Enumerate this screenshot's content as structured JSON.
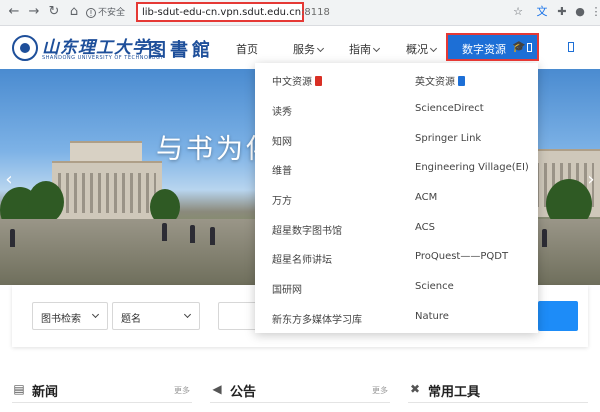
{
  "browser": {
    "not_secure": "不安全",
    "url": "lib-sdut-edu-cn.vpn.sdut.edu.cn",
    "port": ":8118"
  },
  "site": {
    "logo_main": "山东理工大学",
    "logo_sub": "SHANDONG UNIVERSITY OF TECHNOLOGY",
    "logo_lib": "图書館",
    "nav": {
      "home": "首页",
      "service": "服务",
      "guide": "指南",
      "overview": "概况",
      "digital": "数字资源"
    }
  },
  "hero": {
    "title": "与书为伴"
  },
  "search": {
    "type_select": "图书检索",
    "field_select": "题名"
  },
  "dropdown": {
    "left": [
      "中文资源",
      "读秀",
      "知网",
      "维普",
      "万方",
      "超星数字图书馆",
      "超星名师讲坛",
      "国研网",
      "新东方多媒体学习库"
    ],
    "right": [
      "英文资源",
      "ScienceDirect",
      "Springer Link",
      "Engineering Village(EI)",
      "ACM",
      "ACS",
      "ProQuest——PQDT",
      "Science",
      "Nature"
    ],
    "badge_colors": {
      "chinese": "#d93025",
      "english": "#1d6fd6"
    }
  },
  "sections": {
    "news": "新闻",
    "notice": "公告",
    "tools": "常用工具",
    "more": "更多"
  },
  "colors": {
    "primary": "#1d6fd6",
    "highlight": "#e53935",
    "brand": "#1e4f9a"
  }
}
